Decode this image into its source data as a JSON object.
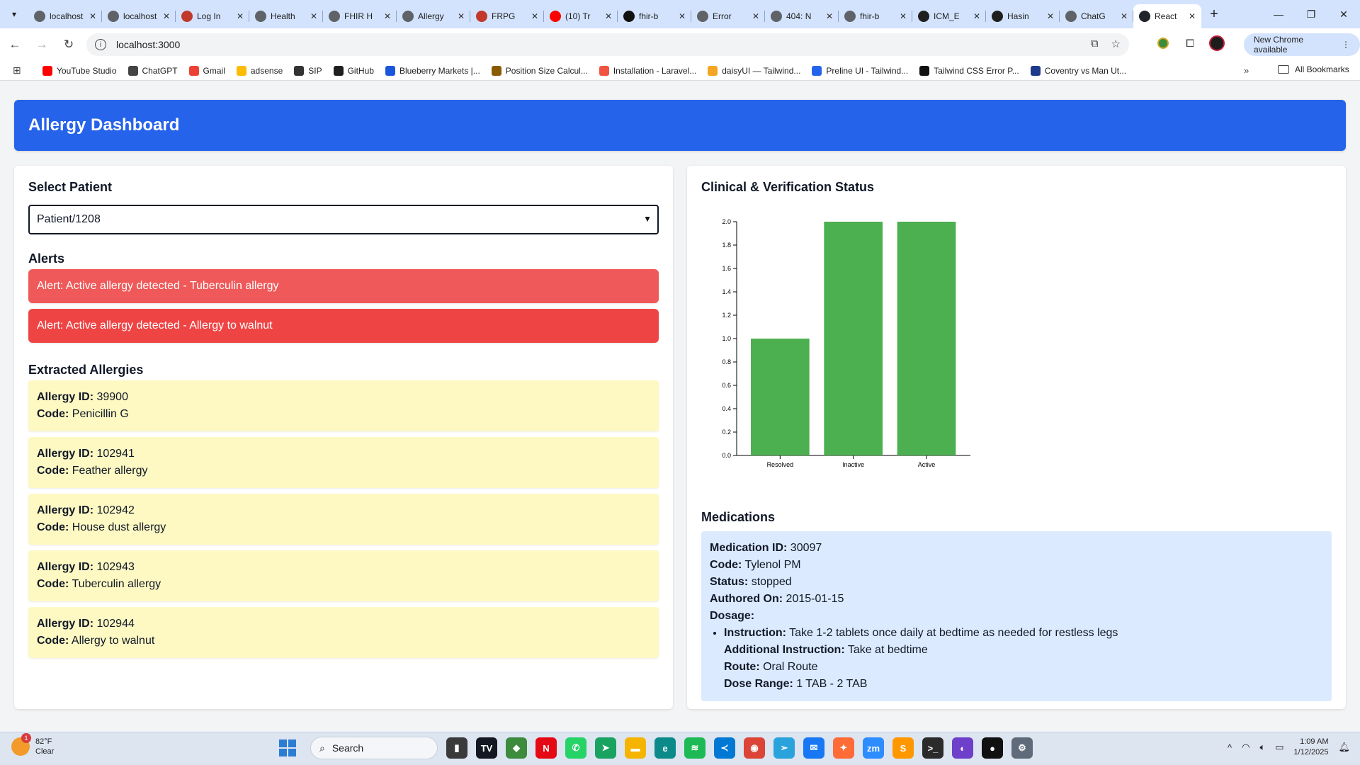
{
  "browser": {
    "tabs": [
      {
        "title": "localhost",
        "icon": "globe-icon",
        "color": "#5f6368"
      },
      {
        "title": "localhost",
        "icon": "globe-icon",
        "color": "#5f6368"
      },
      {
        "title": "Log In",
        "icon": "mail-icon",
        "color": "#c0392b"
      },
      {
        "title": "Health",
        "icon": "globe-icon",
        "color": "#5f6368"
      },
      {
        "title": "FHIR H",
        "icon": "globe-icon",
        "color": "#5f6368"
      },
      {
        "title": "Allergy",
        "icon": "globe-icon",
        "color": "#5f6368"
      },
      {
        "title": "FRPG",
        "icon": "flag-icon",
        "color": "#c0392b"
      },
      {
        "title": "(10) Tr",
        "icon": "youtube-icon",
        "color": "#ff0000"
      },
      {
        "title": "fhir-b",
        "icon": "triangle-icon",
        "color": "#111111"
      },
      {
        "title": "Error",
        "icon": "globe-icon",
        "color": "#5f6368"
      },
      {
        "title": "404: N",
        "icon": "globe-icon",
        "color": "#5f6368"
      },
      {
        "title": "fhir-b",
        "icon": "globe-icon",
        "color": "#5f6368"
      },
      {
        "title": "ICM_E",
        "icon": "github-icon",
        "color": "#1f1f1f"
      },
      {
        "title": "Hasin",
        "icon": "github-icon",
        "color": "#1f1f1f"
      },
      {
        "title": "ChatG",
        "icon": "globe-icon",
        "color": "#5f6368"
      },
      {
        "title": "React",
        "icon": "react-icon",
        "color": "#20232a",
        "active": true
      }
    ],
    "url": "localhost:3000",
    "new_chrome_label": "New Chrome available",
    "bookmarks": [
      {
        "label": "YouTube Studio",
        "color": "#ff0000"
      },
      {
        "label": "ChatGPT",
        "color": "#444444"
      },
      {
        "label": "Gmail",
        "color": "#ea4335"
      },
      {
        "label": "adsense",
        "color": "#fbbc04"
      },
      {
        "label": "SIP",
        "color": "#333333"
      },
      {
        "label": "GitHub",
        "color": "#1f1f1f"
      },
      {
        "label": "Blueberry Markets |...",
        "color": "#1a56db"
      },
      {
        "label": "Position Size Calcul...",
        "color": "#8a5a00"
      },
      {
        "label": "Installation - Laravel...",
        "color": "#f05340"
      },
      {
        "label": "daisyUI — Tailwind...",
        "color": "#f5a524"
      },
      {
        "label": "Preline UI - Tailwind...",
        "color": "#2563eb"
      },
      {
        "label": "Tailwind CSS Error P...",
        "color": "#111111"
      },
      {
        "label": "Coventry vs Man Ut...",
        "color": "#1e3a8a"
      }
    ],
    "all_bookmarks_label": "All Bookmarks"
  },
  "dashboard": {
    "title": "Allergy Dashboard",
    "select_patient_label": "Select Patient",
    "selected_patient": "Patient/1208",
    "alerts_title": "Alerts",
    "alerts": [
      "Alert: Active allergy detected - Tuberculin allergy",
      "Alert: Active allergy detected - Allergy to walnut"
    ],
    "extracted_title": "Extracted Allergies",
    "allergy_id_label": "Allergy ID:",
    "code_label": "Code:",
    "allergies": [
      {
        "id": "39900",
        "code": "Penicillin G"
      },
      {
        "id": "102941",
        "code": "Feather allergy"
      },
      {
        "id": "102942",
        "code": "House dust allergy"
      },
      {
        "id": "102943",
        "code": "Tuberculin allergy"
      },
      {
        "id": "102944",
        "code": "Allergy to walnut"
      }
    ],
    "chart_title": "Clinical & Verification Status",
    "medications_title": "Medications",
    "medication": {
      "id_label": "Medication ID:",
      "id": "30097",
      "code_label": "Code:",
      "code": "Tylenol PM",
      "status_label": "Status:",
      "status": "stopped",
      "authored_label": "Authored On:",
      "authored": "2015-01-15",
      "dosage_label": "Dosage:",
      "instruction_label": "Instruction:",
      "instruction": "Take 1-2 tablets once daily at bedtime as needed for restless legs",
      "additional_label": "Additional Instruction:",
      "additional": "Take at bedtime",
      "route_label": "Route:",
      "route": "Oral Route",
      "dose_range_label": "Dose Range:",
      "dose_range": "1 TAB - 2 TAB"
    }
  },
  "chart_data": {
    "type": "bar",
    "categories": [
      "Resolved",
      "Inactive",
      "Active"
    ],
    "values": [
      1,
      2,
      2
    ],
    "ylim": [
      0,
      2
    ],
    "yticks": [
      "0.0",
      "0.2",
      "0.4",
      "0.6",
      "0.8",
      "1.0",
      "1.2",
      "1.4",
      "1.6",
      "1.8",
      "2.0"
    ],
    "bar_color": "#4caf50",
    "grid": false
  },
  "taskbar": {
    "weather_temp": "82°F",
    "weather_desc": "Clear",
    "weather_badge": "1",
    "search_placeholder": "Search",
    "time": "1:09 AM",
    "date": "1/12/2025",
    "apps": [
      {
        "name": "file-explorer-icon",
        "color": "#3a3a3a",
        "glyph": "▮"
      },
      {
        "name": "tradingview-icon",
        "color": "#131722",
        "glyph": "TV"
      },
      {
        "name": "android-icon",
        "color": "#3d8b3d",
        "glyph": "◆"
      },
      {
        "name": "netflix-icon",
        "color": "#e50914",
        "glyph": "N"
      },
      {
        "name": "whatsapp-icon",
        "color": "#25d366",
        "glyph": "✆"
      },
      {
        "name": "maps-icon",
        "color": "#1aa260",
        "glyph": "➤"
      },
      {
        "name": "folder-icon",
        "color": "#f4b400",
        "glyph": "▬"
      },
      {
        "name": "edge-icon",
        "color": "#0c8a8a",
        "glyph": "e"
      },
      {
        "name": "spotify-icon",
        "color": "#1db954",
        "glyph": "≋"
      },
      {
        "name": "vscode-icon",
        "color": "#0078d4",
        "glyph": "≺"
      },
      {
        "name": "chrome-icon",
        "color": "#db4437",
        "glyph": "◉"
      },
      {
        "name": "telegram-icon",
        "color": "#2aa3dc",
        "glyph": "➢"
      },
      {
        "name": "messenger-icon",
        "color": "#1877f2",
        "glyph": "✉"
      },
      {
        "name": "postman-icon",
        "color": "#ff6c37",
        "glyph": "✦"
      },
      {
        "name": "zoom-icon",
        "color": "#2d8cff",
        "glyph": "zm"
      },
      {
        "name": "sublime-icon",
        "color": "#ff9800",
        "glyph": "S"
      },
      {
        "name": "terminal-icon",
        "color": "#2b2b2b",
        "glyph": ">_"
      },
      {
        "name": "github-desktop-icon",
        "color": "#6e40c9",
        "glyph": "◐"
      },
      {
        "name": "record-icon",
        "color": "#111111",
        "glyph": "●"
      },
      {
        "name": "settings-icon",
        "color": "#5f6b7a",
        "glyph": "⚙"
      }
    ]
  }
}
